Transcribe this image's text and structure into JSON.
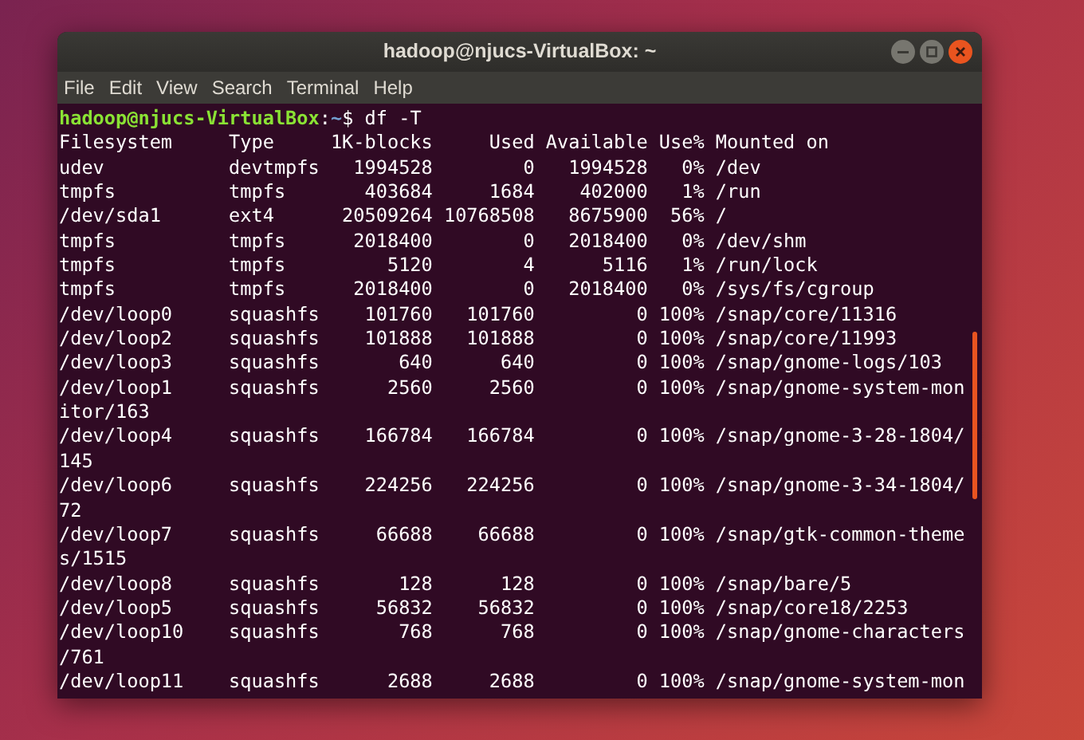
{
  "window": {
    "title": "hadoop@njucs-VirtualBox: ~"
  },
  "menu": [
    "File",
    "Edit",
    "View",
    "Search",
    "Terminal",
    "Help"
  ],
  "prompt": {
    "user_host": "hadoop@njucs-VirtualBox",
    "separator": ":",
    "path": "~",
    "symbol": "$",
    "command": "df -T"
  },
  "lines": [
    "Filesystem     Type     1K-blocks     Used Available Use% Mounted on",
    "udev           devtmpfs   1994528        0   1994528   0% /dev",
    "tmpfs          tmpfs       403684     1684    402000   1% /run",
    "/dev/sda1      ext4      20509264 10768508   8675900  56% /",
    "tmpfs          tmpfs      2018400        0   2018400   0% /dev/shm",
    "tmpfs          tmpfs         5120        4      5116   1% /run/lock",
    "tmpfs          tmpfs      2018400        0   2018400   0% /sys/fs/cgroup",
    "/dev/loop0     squashfs    101760   101760         0 100% /snap/core/11316",
    "/dev/loop2     squashfs    101888   101888         0 100% /snap/core/11993",
    "/dev/loop3     squashfs       640      640         0 100% /snap/gnome-logs/103",
    "/dev/loop1     squashfs      2560     2560         0 100% /snap/gnome-system-mon",
    "itor/163",
    "/dev/loop4     squashfs    166784   166784         0 100% /snap/gnome-3-28-1804/",
    "145",
    "/dev/loop6     squashfs    224256   224256         0 100% /snap/gnome-3-34-1804/",
    "72",
    "/dev/loop7     squashfs     66688    66688         0 100% /snap/gtk-common-theme",
    "s/1515",
    "/dev/loop8     squashfs       128      128         0 100% /snap/bare/5",
    "/dev/loop5     squashfs     56832    56832         0 100% /snap/core18/2253",
    "/dev/loop10    squashfs       768      768         0 100% /snap/gnome-characters",
    "/761",
    "/dev/loop11    squashfs      2688     2688         0 100% /snap/gnome-system-mon"
  ]
}
